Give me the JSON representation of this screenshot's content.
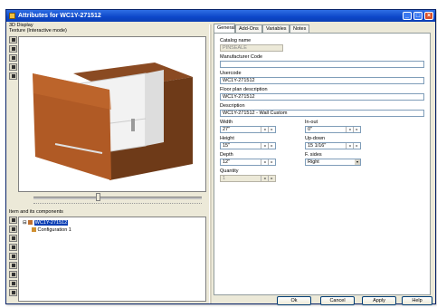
{
  "window": {
    "title": "Attributes for WC1Y-271512"
  },
  "left": {
    "group_label": "3D Display",
    "view_label": "Texture (Interactive mode)",
    "tree_label": "Item and its components",
    "tree": {
      "root": "WC1Y-271512",
      "child": "Configuration 1"
    }
  },
  "tabs": [
    "General",
    "Add-Ons",
    "Variables",
    "Notes"
  ],
  "form": {
    "catalog_name_label": "Catalog name",
    "catalog_name_value": "PINSEALE",
    "manufacturer_code_label": "Manufacturer Code",
    "manufacturer_code_value": "",
    "usercode_label": "Usercode",
    "usercode_value": "WC1Y-271512",
    "floorplan_label": "Floor plan description",
    "floorplan_value": "WC1Y-271512",
    "description_label": "Description",
    "description_value": "WC1Y-271512 - Wall Custom",
    "width_label": "Width",
    "width_value": "27\"",
    "inout_label": "In-out",
    "inout_value": "0\"",
    "height_label": "Height",
    "height_value": "15\"",
    "updown_label": "Up-down",
    "updown_value": "15 1/16\"",
    "depth_label": "Depth",
    "depth_value": "12\"",
    "fsides_label": "F. sides",
    "fsides_value": "Right",
    "quantity_label": "Quantity",
    "quantity_value": "1"
  },
  "buttons": {
    "ok": "Ok",
    "cancel": "Cancel",
    "apply": "Apply",
    "help": "Help"
  }
}
